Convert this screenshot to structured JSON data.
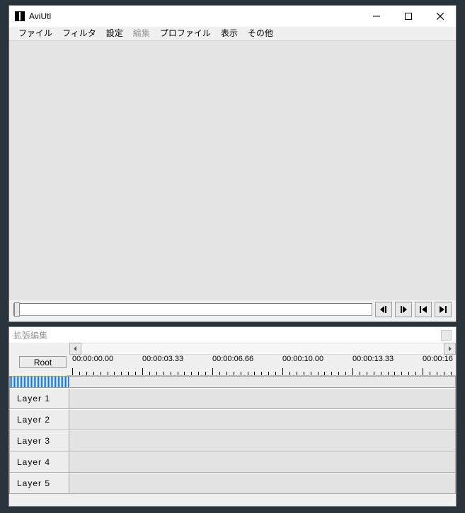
{
  "main": {
    "title": "AviUtl",
    "menu": [
      {
        "label": "ファイル",
        "disabled": false
      },
      {
        "label": "フィルタ",
        "disabled": false
      },
      {
        "label": "設定",
        "disabled": false
      },
      {
        "label": "編集",
        "disabled": true
      },
      {
        "label": "プロファイル",
        "disabled": false
      },
      {
        "label": "表示",
        "disabled": false
      },
      {
        "label": "その他",
        "disabled": false
      }
    ]
  },
  "timeline": {
    "title": "拡張編集",
    "root_label": "Root",
    "time_labels": [
      "00:00:00.00",
      "00:00:03.33",
      "00:00:06.66",
      "00:00:10.00",
      "00:00:13.33",
      "00:00:16"
    ],
    "layers": [
      "Layer 1",
      "Layer 2",
      "Layer 3",
      "Layer 4",
      "Layer 5"
    ]
  }
}
